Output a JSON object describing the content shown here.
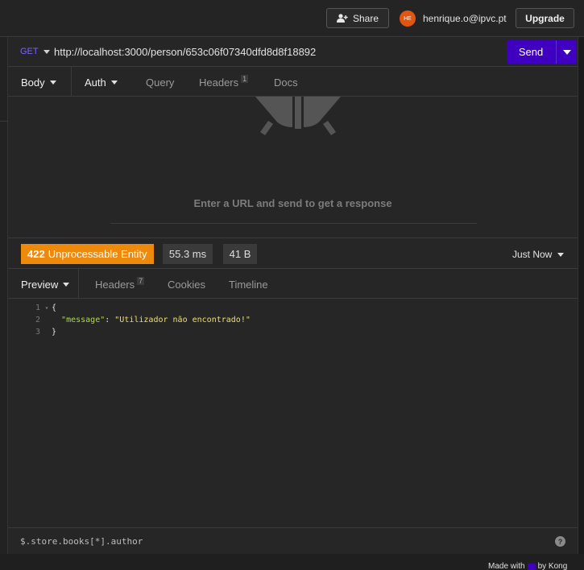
{
  "topbar": {
    "share_label": "Share",
    "avatar_initials": "HE",
    "user_email": "henrique.o@ipvc.pt",
    "upgrade_label": "Upgrade",
    "avatar_color": "#e0550f"
  },
  "request": {
    "method": "GET",
    "url": "http://localhost:3000/person/653c06f07340dfd8d8f18892",
    "send_label": "Send",
    "accent_color": "#4000bf",
    "tabs": [
      {
        "label": "Body",
        "icon": "caret-down-icon"
      },
      {
        "label": "Auth",
        "icon": "caret-down-icon"
      },
      {
        "label": "Query"
      },
      {
        "label": "Headers",
        "count": "1"
      },
      {
        "label": "Docs"
      }
    ],
    "empty_message": "Enter a URL and send to get a response"
  },
  "response": {
    "status_code": "422",
    "status_text": "Unprocessable Entity",
    "status_color": "#ee8a0b",
    "time": "55.3 ms",
    "size": "41 B",
    "timestamp": "Just Now",
    "tabs": [
      {
        "label": "Preview",
        "icon": "caret-down-icon"
      },
      {
        "label": "Headers",
        "count": "7"
      },
      {
        "label": "Cookies"
      },
      {
        "label": "Timeline"
      }
    ],
    "lines": [
      {
        "num": "1",
        "text": "{"
      },
      {
        "num": "2",
        "key": "\"message\"",
        "sep": ": ",
        "value": "\"Utilizador não encontrado!\""
      },
      {
        "num": "3",
        "text": "}"
      }
    ]
  },
  "filter": {
    "value": "$.store.books[*].author",
    "help_icon": "question-icon"
  },
  "footer": {
    "made_with": "Made with",
    "by": "by Kong"
  }
}
